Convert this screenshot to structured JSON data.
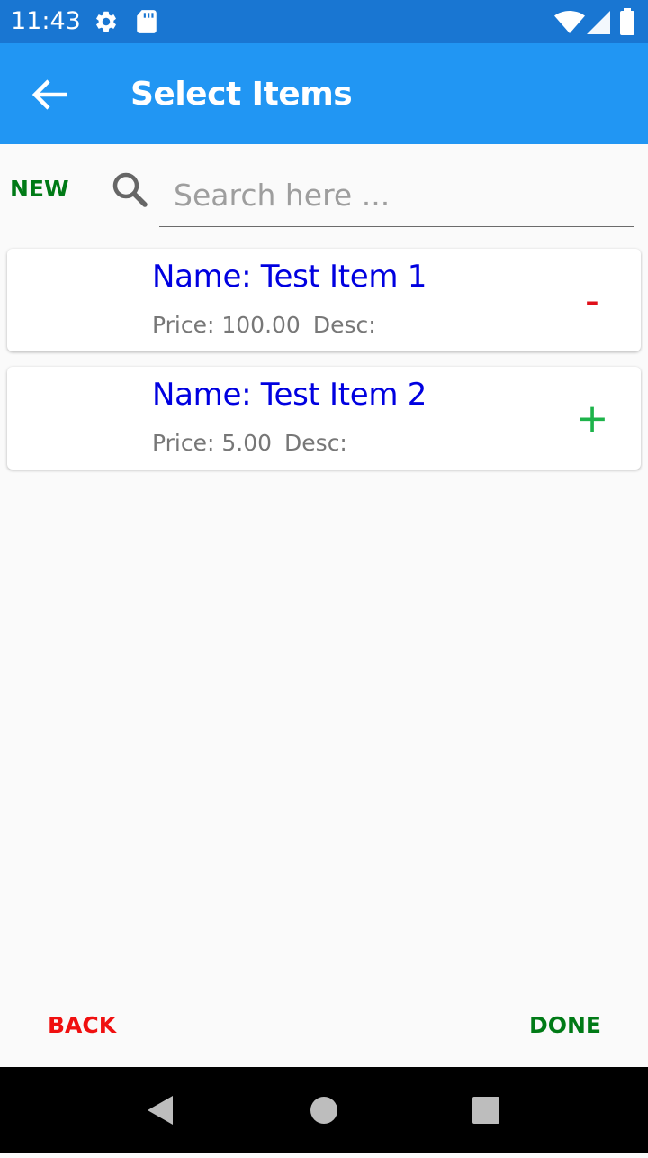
{
  "status_bar": {
    "time": "11:43",
    "icons": [
      "gear-icon",
      "sd-card-icon",
      "wifi-icon",
      "signal-icon",
      "battery-icon"
    ]
  },
  "app_bar": {
    "title": "Select Items",
    "back_icon": "arrow-left-icon"
  },
  "search_row": {
    "new_label": "NEW",
    "search_icon": "search-icon",
    "placeholder": "Search here ...",
    "value": ""
  },
  "items": [
    {
      "name": "Name: Test Item 1",
      "price": "Price: 100.00",
      "desc": "Desc:",
      "action": "-",
      "action_color": "#e0101a"
    },
    {
      "name": "Name: Test Item 2",
      "price": "Price: 5.00",
      "desc": "Desc:",
      "action": "+",
      "action_color": "#1db34a"
    }
  ],
  "footer": {
    "back_label": "BACK",
    "done_label": "DONE"
  },
  "nav_bar": {
    "icons": [
      "nav-back-triangle-icon",
      "nav-home-circle-icon",
      "nav-recents-square-icon"
    ]
  },
  "colors": {
    "status_bar": "#1976d2",
    "app_bar": "#2196f3",
    "new_done": "#007a16",
    "back": "#f01010",
    "item_name": "#0000e0"
  }
}
